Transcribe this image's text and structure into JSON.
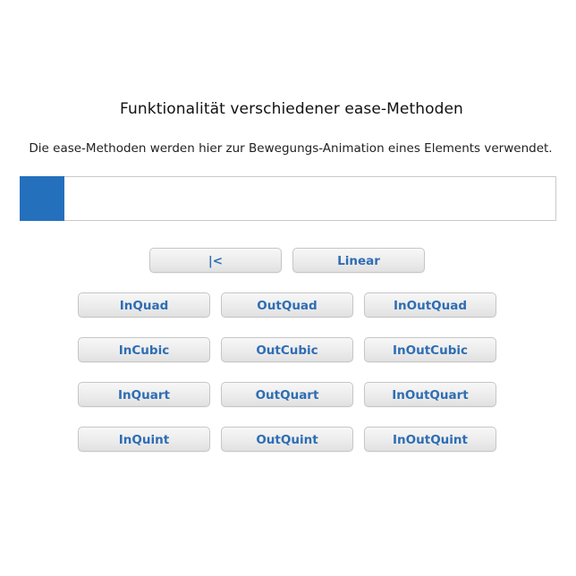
{
  "header": {
    "title": "Funktionalität verschiedener ease-Methoden",
    "subtitle": "Die ease-Methoden werden hier zur Bewegungs-Animation eines Elements verwendet."
  },
  "animation": {
    "progress_fraction": 0.0,
    "mover_color": "#2470bd",
    "track_border_color": "#cacaca"
  },
  "controls": {
    "reset_label": "|<",
    "linear_label": "Linear"
  },
  "ease_buttons": [
    [
      "InQuad",
      "OutQuad",
      "InOutQuad"
    ],
    [
      "InCubic",
      "OutCubic",
      "InOutCubic"
    ],
    [
      "InQuart",
      "OutQuart",
      "InOutQuart"
    ],
    [
      "InQuint",
      "OutQuint",
      "InOutQuint"
    ]
  ],
  "colors": {
    "button_text": "#2e6db4",
    "button_border": "#c6c6c6"
  }
}
